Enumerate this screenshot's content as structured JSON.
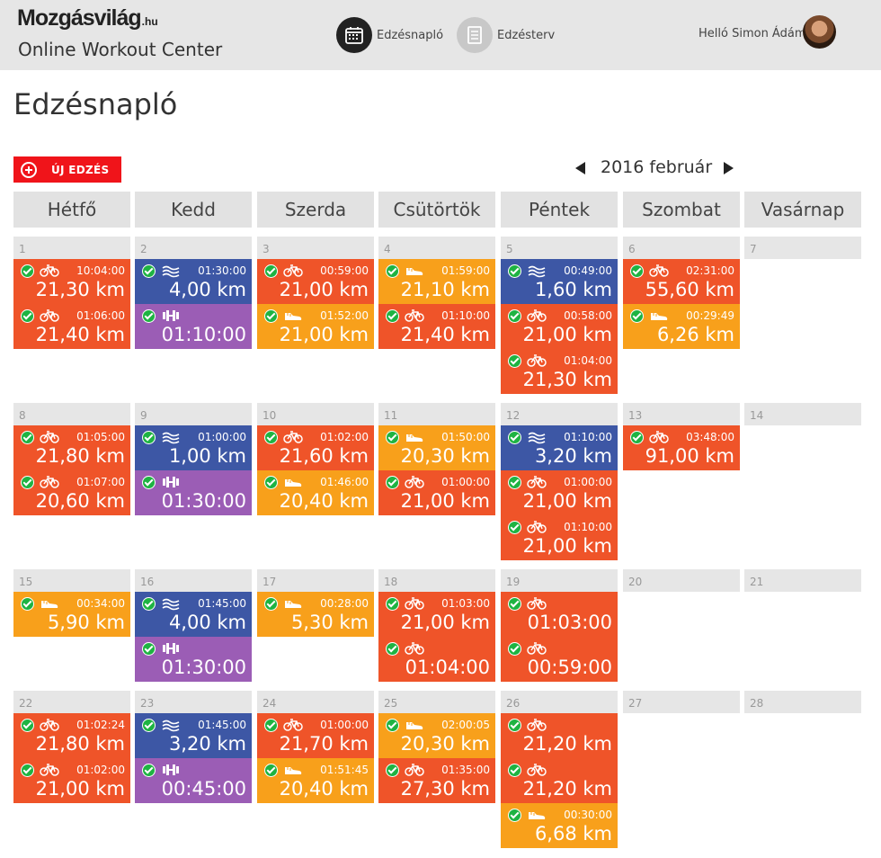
{
  "header": {
    "logo": "Mozgásvilág",
    "logo_suffix": ".hu",
    "subtitle": "Online Workout Center",
    "nav": [
      {
        "label": "Edzésnapló",
        "icon": "calendar-icon",
        "active": true
      },
      {
        "label": "Edzésterv",
        "icon": "list-icon",
        "active": false
      }
    ],
    "greeting": "Helló Simon Ádám"
  },
  "page": {
    "title": "Edzésnapló",
    "new_button": "ÚJ EDZÉS",
    "month": "2016 február"
  },
  "weekdays": [
    "Hétfő",
    "Kedd",
    "Szerda",
    "Csütörtök",
    "Péntek",
    "Szombat",
    "Vasárnap"
  ],
  "colors": {
    "cycling": "#ef5429",
    "swimming": "#3d57a5",
    "strength": "#9b5db5",
    "running": "#f8a01b",
    "accent": "#f0141a",
    "done": "#1eb342"
  },
  "weeks": [
    [
      {
        "day": "1",
        "entries": [
          {
            "sport": "bike-icon",
            "color": "orange-red",
            "time": "10:04:00",
            "value": "21,30 km"
          },
          {
            "sport": "bike-icon",
            "color": "orange-red",
            "time": "01:06:00",
            "value": "21,40 km"
          }
        ]
      },
      {
        "day": "2",
        "entries": [
          {
            "sport": "swim-icon",
            "color": "blue",
            "time": "01:30:00",
            "value": "4,00 km"
          },
          {
            "sport": "dumbbell-icon",
            "color": "purple",
            "time": "",
            "value": "01:10:00"
          }
        ]
      },
      {
        "day": "3",
        "entries": [
          {
            "sport": "bike-icon",
            "color": "orange-red",
            "time": "00:59:00",
            "value": "21,00 km"
          },
          {
            "sport": "shoe-icon",
            "color": "orange",
            "time": "01:52:00",
            "value": "21,00 km"
          }
        ]
      },
      {
        "day": "4",
        "entries": [
          {
            "sport": "shoe-icon",
            "color": "orange",
            "time": "01:59:00",
            "value": "21,10 km"
          },
          {
            "sport": "bike-icon",
            "color": "orange-red",
            "time": "01:10:00",
            "value": "21,40 km"
          }
        ]
      },
      {
        "day": "5",
        "entries": [
          {
            "sport": "swim-icon",
            "color": "blue",
            "time": "00:49:00",
            "value": "1,60 km"
          },
          {
            "sport": "bike-icon",
            "color": "orange-red",
            "time": "00:58:00",
            "value": "21,00 km"
          },
          {
            "sport": "bike-icon",
            "color": "orange-red",
            "time": "01:04:00",
            "value": "21,30 km"
          }
        ]
      },
      {
        "day": "6",
        "entries": [
          {
            "sport": "bike-icon",
            "color": "orange-red",
            "time": "02:31:00",
            "value": "55,60 km"
          },
          {
            "sport": "shoe-icon",
            "color": "orange",
            "time": "00:29:49",
            "value": "6,26 km"
          }
        ]
      },
      {
        "day": "7",
        "entries": []
      }
    ],
    [
      {
        "day": "8",
        "entries": [
          {
            "sport": "bike-icon",
            "color": "orange-red",
            "time": "01:05:00",
            "value": "21,80 km"
          },
          {
            "sport": "bike-icon",
            "color": "orange-red",
            "time": "01:07:00",
            "value": "20,60 km"
          }
        ]
      },
      {
        "day": "9",
        "entries": [
          {
            "sport": "swim-icon",
            "color": "blue",
            "time": "01:00:00",
            "value": "1,00 km"
          },
          {
            "sport": "dumbbell-icon",
            "color": "purple",
            "time": "",
            "value": "01:30:00"
          }
        ]
      },
      {
        "day": "10",
        "entries": [
          {
            "sport": "bike-icon",
            "color": "orange-red",
            "time": "01:02:00",
            "value": "21,60 km"
          },
          {
            "sport": "shoe-icon",
            "color": "orange",
            "time": "01:46:00",
            "value": "20,40 km"
          }
        ]
      },
      {
        "day": "11",
        "entries": [
          {
            "sport": "shoe-icon",
            "color": "orange",
            "time": "01:50:00",
            "value": "20,30 km"
          },
          {
            "sport": "bike-icon",
            "color": "orange-red",
            "time": "01:00:00",
            "value": "21,00 km"
          }
        ]
      },
      {
        "day": "12",
        "entries": [
          {
            "sport": "swim-icon",
            "color": "blue",
            "time": "01:10:00",
            "value": "3,20 km"
          },
          {
            "sport": "bike-icon",
            "color": "orange-red",
            "time": "01:00:00",
            "value": "21,00 km"
          },
          {
            "sport": "bike-icon",
            "color": "orange-red",
            "time": "01:10:00",
            "value": "21,00 km"
          }
        ]
      },
      {
        "day": "13",
        "entries": [
          {
            "sport": "bike-icon",
            "color": "orange-red",
            "time": "03:48:00",
            "value": "91,00 km"
          }
        ]
      },
      {
        "day": "14",
        "entries": []
      }
    ],
    [
      {
        "day": "15",
        "entries": [
          {
            "sport": "shoe-icon",
            "color": "orange",
            "time": "00:34:00",
            "value": "5,90 km"
          }
        ]
      },
      {
        "day": "16",
        "entries": [
          {
            "sport": "swim-icon",
            "color": "blue",
            "time": "01:45:00",
            "value": "4,00 km"
          },
          {
            "sport": "dumbbell-icon",
            "color": "purple",
            "time": "",
            "value": "01:30:00"
          }
        ]
      },
      {
        "day": "17",
        "entries": [
          {
            "sport": "shoe-icon",
            "color": "orange",
            "time": "00:28:00",
            "value": "5,30 km"
          }
        ]
      },
      {
        "day": "18",
        "entries": [
          {
            "sport": "bike-icon",
            "color": "orange-red",
            "time": "01:03:00",
            "value": "21,00 km"
          },
          {
            "sport": "bike-icon",
            "color": "orange-red",
            "time": "",
            "value": "01:04:00"
          }
        ]
      },
      {
        "day": "19",
        "entries": [
          {
            "sport": "bike-icon",
            "color": "orange-red",
            "time": "",
            "value": "01:03:00"
          },
          {
            "sport": "bike-icon",
            "color": "orange-red",
            "time": "",
            "value": "00:59:00"
          }
        ]
      },
      {
        "day": "20",
        "entries": []
      },
      {
        "day": "21",
        "entries": []
      }
    ],
    [
      {
        "day": "22",
        "entries": [
          {
            "sport": "bike-icon",
            "color": "orange-red",
            "time": "01:02:24",
            "value": "21,80 km"
          },
          {
            "sport": "bike-icon",
            "color": "orange-red",
            "time": "01:02:00",
            "value": "21,00 km"
          }
        ]
      },
      {
        "day": "23",
        "entries": [
          {
            "sport": "swim-icon",
            "color": "blue",
            "time": "01:45:00",
            "value": "3,20 km"
          },
          {
            "sport": "dumbbell-icon",
            "color": "purple",
            "time": "",
            "value": "00:45:00"
          }
        ]
      },
      {
        "day": "24",
        "entries": [
          {
            "sport": "bike-icon",
            "color": "orange-red",
            "time": "01:00:00",
            "value": "21,70 km"
          },
          {
            "sport": "shoe-icon",
            "color": "orange",
            "time": "01:51:45",
            "value": "20,40 km"
          }
        ]
      },
      {
        "day": "25",
        "entries": [
          {
            "sport": "shoe-icon",
            "color": "orange",
            "time": "02:00:05",
            "value": "20,30 km"
          },
          {
            "sport": "bike-icon",
            "color": "orange-red",
            "time": "01:35:00",
            "value": "27,30 km"
          }
        ]
      },
      {
        "day": "26",
        "entries": [
          {
            "sport": "bike-icon",
            "color": "orange-red",
            "time": "",
            "value": "21,20 km"
          },
          {
            "sport": "bike-icon",
            "color": "orange-red",
            "time": "",
            "value": "21,20 km"
          },
          {
            "sport": "shoe-icon",
            "color": "orange",
            "time": "00:30:00",
            "value": "6,68 km"
          }
        ]
      },
      {
        "day": "27",
        "entries": []
      },
      {
        "day": "28",
        "entries": []
      }
    ]
  ]
}
